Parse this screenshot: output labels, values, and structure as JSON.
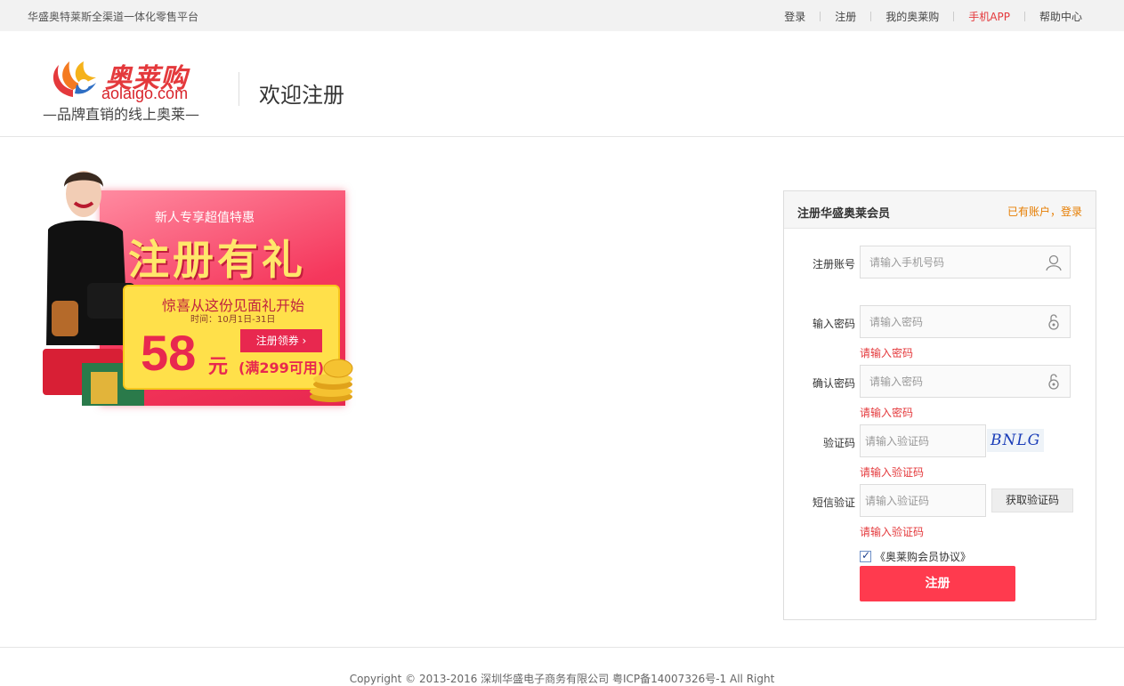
{
  "topbar": {
    "slogan": "华盛奥特莱斯全渠道一体化零售平台",
    "nav": [
      {
        "label": "登录",
        "highlight": false
      },
      {
        "label": "注册",
        "highlight": false
      },
      {
        "label": "我的奥莱购",
        "highlight": false
      },
      {
        "label": "手机APP",
        "highlight": true
      },
      {
        "label": "帮助中心",
        "highlight": false
      }
    ]
  },
  "header": {
    "logo_cn": "奥莱购",
    "logo_en": "aolaigo.com",
    "logo_tagline": "—品牌直销的线上奥莱—",
    "welcome": "欢迎注册"
  },
  "banner": {
    "subtitle": "新人专享超值特惠",
    "headline": "注册有礼",
    "card_title": "惊喜从这份见面礼开始",
    "card_time": "时间：10月1日-31日",
    "amount": "58",
    "currency": "元",
    "condition": "(满299可用)",
    "button": "注册领券 ›"
  },
  "register": {
    "title": "注册华盛奥莱会员",
    "login_link": "已有账户，登录",
    "account": {
      "label": "注册账号",
      "placeholder": "请输入手机号码",
      "value": ""
    },
    "password": {
      "label": "输入密码",
      "placeholder": "请输入密码",
      "value": "",
      "error": "请输入密码"
    },
    "confirm": {
      "label": "确认密码",
      "placeholder": "请输入密码",
      "value": "",
      "error": "请输入密码"
    },
    "captcha": {
      "label": "验证码",
      "placeholder": "请输入验证码",
      "value": "",
      "image_text": "BNLG",
      "error": "请输入验证码"
    },
    "sms": {
      "label": "短信验证",
      "placeholder": "请输入验证码",
      "value": "",
      "button": "获取验证码",
      "error": "请输入验证码"
    },
    "agreement": {
      "checked": true,
      "label": "《奥莱购会员协议》"
    },
    "submit": "注册"
  },
  "footer": {
    "copyright": "Copyright © 2013-2016 深圳华盛电子商务有限公司 粤ICP备14007326号-1 All Right"
  },
  "colors": {
    "brand_red": "#e4393c",
    "button_red": "#ff3a4e",
    "link_orange": "#e67d00"
  },
  "icons": {
    "account": "user-icon",
    "password": "lock-icon",
    "confirm": "lock-icon"
  }
}
